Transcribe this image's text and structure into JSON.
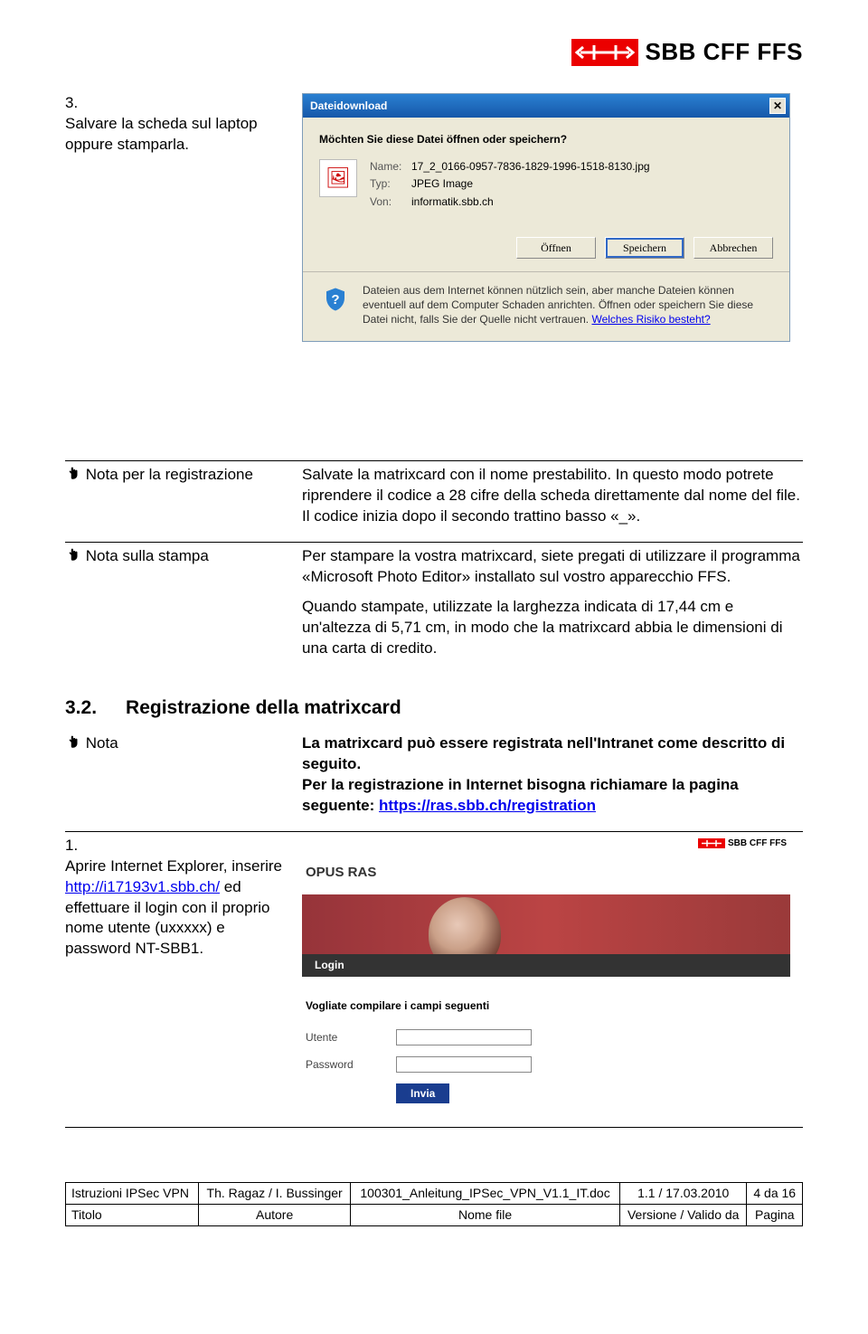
{
  "logo_text": "SBB CFF FFS",
  "step3": {
    "num": "3.",
    "text": "Salvare la scheda sul laptop oppure stamparla."
  },
  "dialog": {
    "title": "Dateidownload",
    "question": "Möchten Sie diese Datei öffnen oder speichern?",
    "name_label": "Name:",
    "name_value": "17_2_0166-0957-7836-1829-1996-1518-8130.jpg",
    "type_label": "Typ:",
    "type_value": "JPEG Image",
    "from_label": "Von:",
    "from_value": "informatik.sbb.ch",
    "btn_open": "Öffnen",
    "btn_save": "Speichern",
    "btn_cancel": "Abbrechen",
    "warn_text": "Dateien aus dem Internet können nützlich sein, aber manche Dateien können eventuell auf dem Computer Schaden anrichten. Öffnen oder speichern Sie diese Datei nicht, falls Sie der Quelle nicht vertrauen. ",
    "warn_link": "Welches Risiko besteht?"
  },
  "nota_reg": {
    "label": "Nota per la registrazione",
    "text": "Salvate la matrixcard con il nome prestabilito. In questo modo potrete riprendere il codice a 28 cifre della scheda direttamente dal nome del file. Il codice inizia dopo il secondo trattino basso «_»."
  },
  "nota_stampa": {
    "label": "Nota sulla stampa",
    "p1": "Per stampare la vostra matrixcard, siete pregati di utilizzare il programma «Microsoft Photo Editor» installato sul vostro apparecchio FFS.",
    "p2": "Quando stampate, utilizzate la larghezza indicata di 17,44 cm e un'altezza di 5,71 cm, in modo che la matrixcard abbia le dimensioni di una carta di credito."
  },
  "sec32": {
    "num": "3.2.",
    "title": "Registrazione della matrixcard"
  },
  "nota32": {
    "label": "Nota",
    "line1": "La matrixcard può essere registrata nell'Intranet come descritto di seguito.",
    "line2_pre": "Per la registrazione in Internet bisogna richiamare la pagina seguente: ",
    "line2_link": "https://ras.sbb.ch/registration"
  },
  "step1": {
    "num": "1.",
    "pre": "Aprire Internet Explorer, inserire ",
    "link": "http://i17193v1.sbb.ch/",
    "post": " ed effettuare il login con il proprio nome utente (uxxxxx) e password NT-SBB1."
  },
  "opus": {
    "title": "OPUS RAS",
    "login": "Login",
    "note": "Vogliate compilare i campi seguenti",
    "utente_lb": "Utente",
    "password_lb": "Password",
    "submit": "Invia"
  },
  "footer": {
    "c1a": "Istruzioni IPSec VPN",
    "c2a": "Th. Ragaz / I. Bussinger",
    "c3a": "100301_Anleitung_IPSec_VPN_V1.1_IT.doc",
    "c4a": "1.1 / 17.03.2010",
    "c5a": "4 da 16",
    "c1b": "Titolo",
    "c2b": "Autore",
    "c3b": "Nome file",
    "c4b": "Versione / Valido da",
    "c5b": "Pagina"
  }
}
